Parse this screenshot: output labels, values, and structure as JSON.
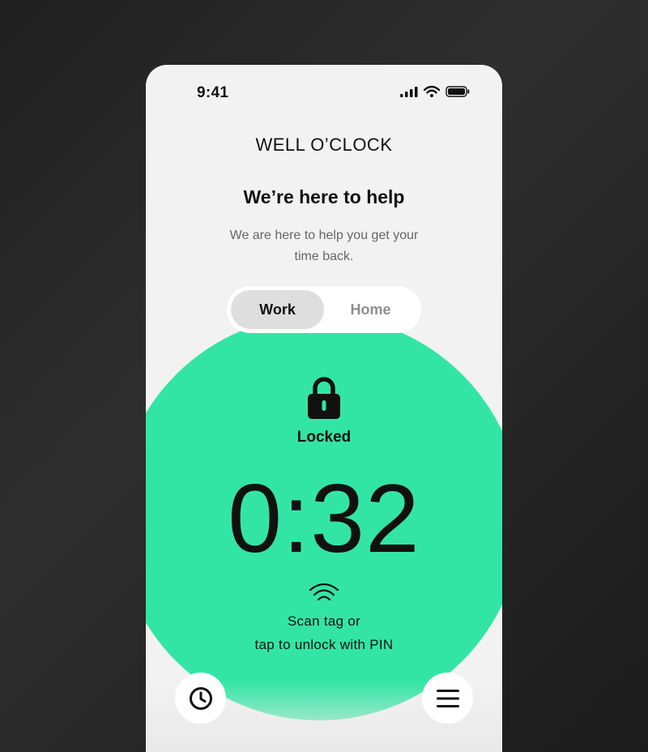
{
  "status_bar": {
    "time": "9:41",
    "icons": [
      "cellular-signal-icon",
      "wifi-icon",
      "battery-icon"
    ]
  },
  "app": {
    "logo": "WELL O’CLOCK",
    "title": "We’re here to help",
    "subtitle": "We are here to help you get your time back."
  },
  "mode_toggle": {
    "options": [
      {
        "label": "Work",
        "selected": true
      },
      {
        "label": "Home",
        "selected": false
      }
    ]
  },
  "lock_panel": {
    "icon": "lock-icon",
    "status": "Locked",
    "timer": "0:32",
    "nfc_icon": "nfc-icon",
    "instruction_line1": "Scan tag or",
    "instruction_line2": "tap to unlock with PIN"
  },
  "bottom_actions": {
    "history_icon": "clock-icon",
    "menu_icon": "hamburger-menu-icon"
  },
  "colors": {
    "background": "#242424",
    "screen": "#f2f2f2",
    "accent": "#33e5a5",
    "text": "#111111",
    "muted_text": "#666666"
  }
}
